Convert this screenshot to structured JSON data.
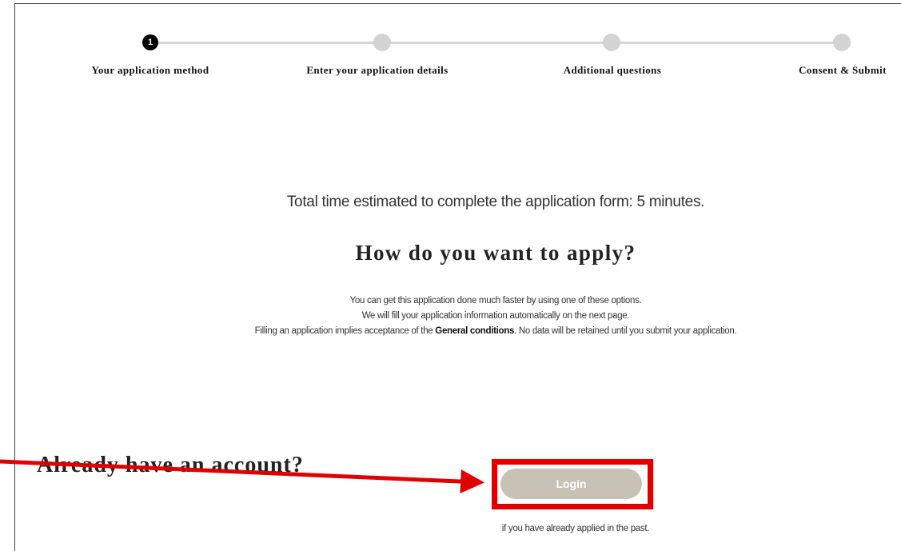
{
  "steps": [
    {
      "number": "1",
      "label": "Your application method",
      "active": true
    },
    {
      "number": "",
      "label": "Enter your application details",
      "active": false
    },
    {
      "number": "",
      "label": "Additional questions",
      "active": false
    },
    {
      "number": "",
      "label": "Consent & Submit",
      "active": false
    }
  ],
  "main": {
    "time_estimate": "Total time estimated to complete the application form: 5 minutes.",
    "question": "How do you want to apply?",
    "info_line1": "You can get this application done much faster by using one of these options.",
    "info_line2": "We will fill your application information automatically on the next page.",
    "info_line3_pre": "Filling an application implies acceptance of the ",
    "info_line3_link": "General conditions",
    "info_line3_post": ". No data will be retained until you submit your application."
  },
  "account": {
    "heading": "Already have an account?",
    "login_label": "Login",
    "note": "if you have already applied in the past."
  },
  "colors": {
    "highlight": "#e10000",
    "login_button": "#c8c1b6",
    "step_active": "#000000",
    "step_inactive": "#d3d3d3"
  }
}
